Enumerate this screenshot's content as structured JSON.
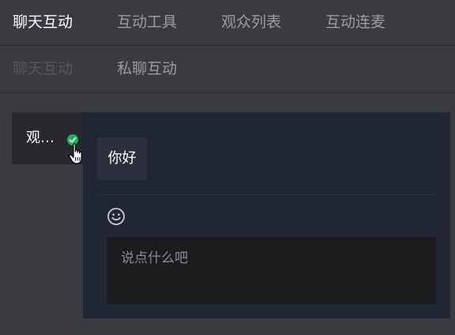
{
  "tabs": [
    {
      "label": "聊天互动",
      "active": true
    },
    {
      "label": "互动工具",
      "active": false
    },
    {
      "label": "观众列表",
      "active": false
    },
    {
      "label": "互动连麦",
      "active": false
    }
  ],
  "subtabs": [
    {
      "label": "聊天互动",
      "active": true
    },
    {
      "label": "私聊互动",
      "active": false
    }
  ],
  "user_list": {
    "selected_user": "观…"
  },
  "chat": {
    "messages": [
      "你好"
    ],
    "input_placeholder": "说点什么吧",
    "input_value": ""
  },
  "icons": {
    "status": "check-circle-icon",
    "pointer": "hand-pointer-icon",
    "emoji": "smiley-icon"
  },
  "colors": {
    "background": "#3a3b3f",
    "panel": "#212634",
    "accent_green": "#19b35a"
  }
}
